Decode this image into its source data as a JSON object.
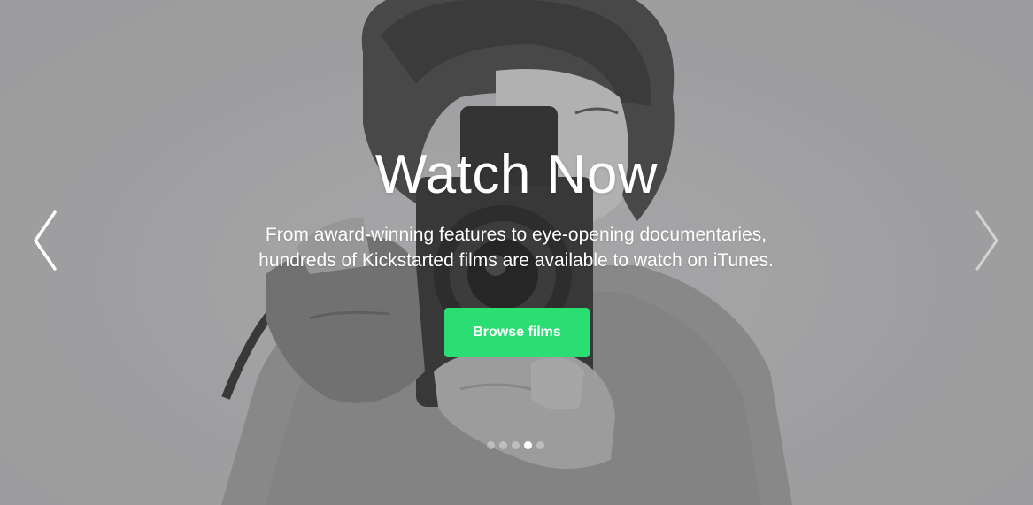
{
  "hero": {
    "title": "Watch Now",
    "subtitle_line1": "From award-winning features to eye-opening documentaries,",
    "subtitle_line2": "hundreds of Kickstarted films are available to watch on iTunes.",
    "cta_label": "Browse films",
    "cta_color": "#2bde73"
  },
  "carousel": {
    "prev_icon": "chevron-left-icon",
    "next_icon": "chevron-right-icon",
    "slide_count": 5,
    "active_slide": 4
  },
  "image": {
    "description_icon": "woman-with-camera-photo"
  }
}
